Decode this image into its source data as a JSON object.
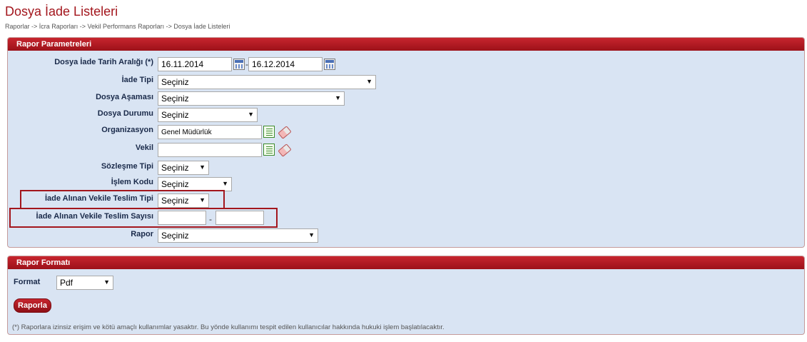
{
  "page": {
    "title": "Dosya İade Listeleri",
    "breadcrumb": "Raporlar -> İcra Raporları -> Vekil Performans Raporları -> Dosya İade Listeleri"
  },
  "params": {
    "header": "Rapor Parametreleri",
    "date_range": {
      "label": "Dosya İade Tarih Aralığı (*)",
      "from": "16.11.2014",
      "separator": "-",
      "to": "16.12.2014"
    },
    "iade_tipi": {
      "label": "İade Tipi",
      "value": "Seçiniz"
    },
    "dosya_asamasi": {
      "label": "Dosya Aşaması",
      "value": "Seçiniz"
    },
    "dosya_durumu": {
      "label": "Dosya Durumu",
      "value": "Seçiniz"
    },
    "organizasyon": {
      "label": "Organizasyon",
      "value": "Genel Müdürlük"
    },
    "vekil": {
      "label": "Vekil",
      "value": ""
    },
    "sozlesme_tipi": {
      "label": "Sözleşme Tipi",
      "value": "Seçiniz"
    },
    "islem_kodu": {
      "label": "İşlem Kodu",
      "value": "Seçiniz"
    },
    "teslim_tipi": {
      "label": "İade Alınan Vekile Teslim Tipi",
      "value": "Seçiniz"
    },
    "teslim_sayisi": {
      "label": "İade Alınan Vekile Teslim Sayısı",
      "from": "",
      "separator": "-",
      "to": ""
    },
    "rapor": {
      "label": "Rapor",
      "value": "Seçiniz"
    }
  },
  "format": {
    "header": "Rapor Formatı",
    "label": "Format",
    "value": "Pdf",
    "button": "Raporla",
    "note": "(*) Raporlara izinsiz erişim ve kötü amaçlı kullanımlar yasaktır. Bu yönde kullanımı tespit edilen kullanıcılar hakkında hukuki işlem başlatılacaktır."
  },
  "arrow_glyph": "▼"
}
